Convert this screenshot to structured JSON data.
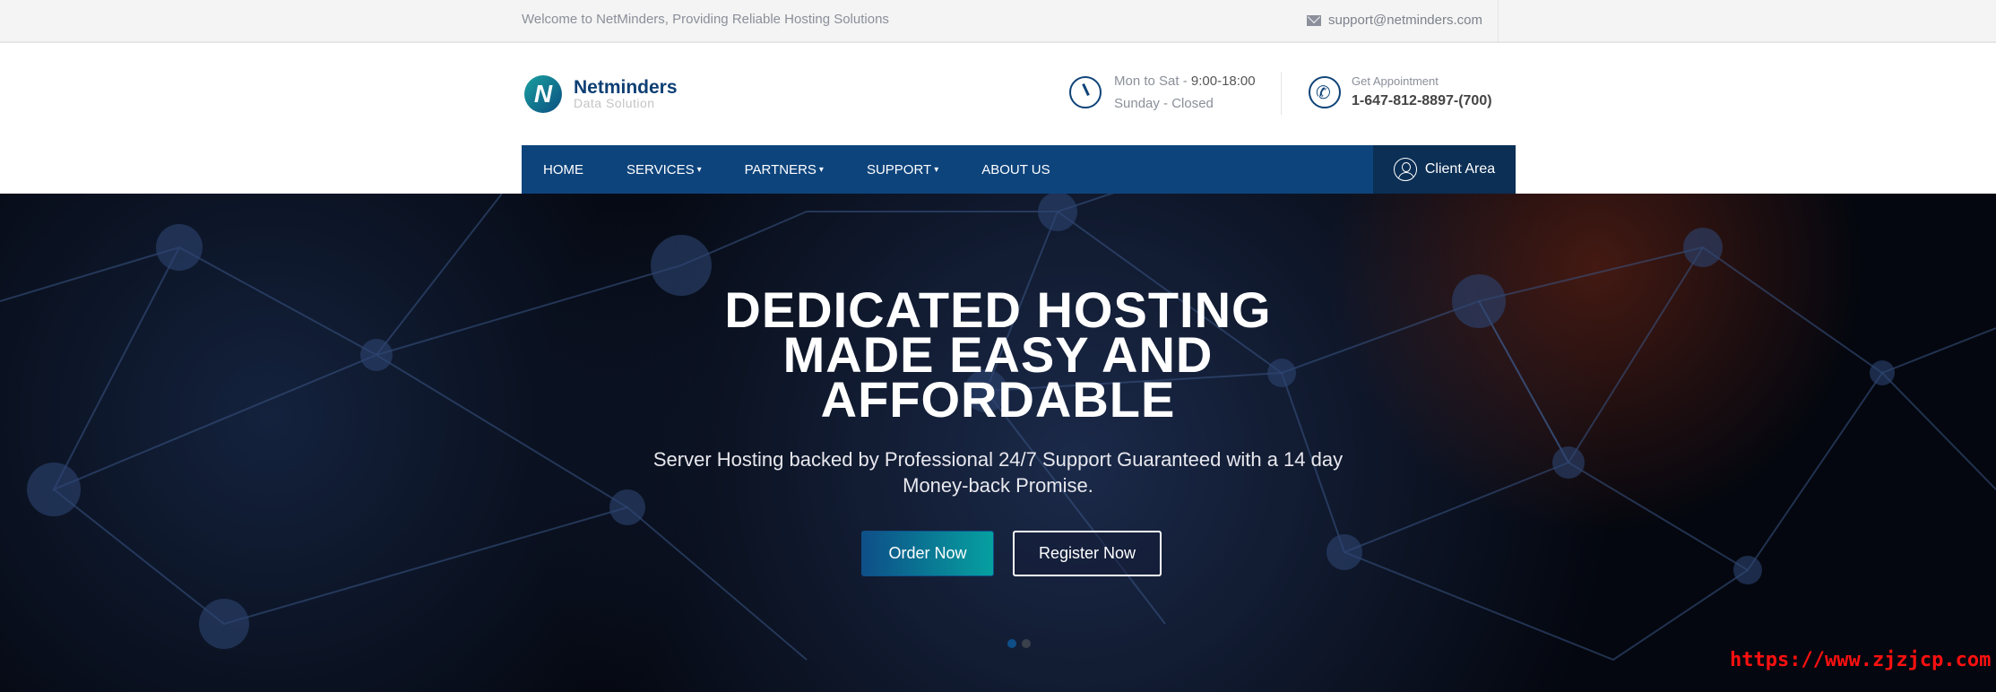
{
  "topbar": {
    "welcome": "Welcome to NetMinders, Providing Reliable Hosting Solutions",
    "email": "support@netminders.com",
    "email_icon": "envelope-icon"
  },
  "header": {
    "logo_name": "Netminders",
    "logo_sub": "Data Solution",
    "hours_line1_prefix": "Mon to Sat - ",
    "hours_line1_time": "9:00-18:00",
    "hours_line2": "Sunday - Closed",
    "appointment_label": "Get Appointment",
    "phone": "1-647-812-8897-(700)"
  },
  "nav": {
    "items": [
      {
        "label": "HOME",
        "dropdown": false
      },
      {
        "label": "SERVICES",
        "dropdown": true
      },
      {
        "label": "PARTNERS",
        "dropdown": true
      },
      {
        "label": "SUPPORT",
        "dropdown": true
      },
      {
        "label": "ABOUT US",
        "dropdown": false
      }
    ],
    "client_area": "Client Area",
    "caret": "▾"
  },
  "hero": {
    "title_lines": [
      "DEDICATED HOSTING",
      "MADE EASY AND",
      "AFFORDABLE"
    ],
    "subtitle_lines": [
      "Server Hosting backed by Professional 24/7 Support Guaranteed with a 14 day",
      "Money-back Promise."
    ],
    "order_button": "Order Now",
    "register_button": "Register Now",
    "slide_count": 2,
    "active_slide": 1
  },
  "watermark": "https://www.zjzjcp.com",
  "colors": {
    "nav": "#0e447c",
    "client_area": "#0b2f55",
    "accent_teal": "#06a0a0",
    "watermark": "#ff1010"
  }
}
